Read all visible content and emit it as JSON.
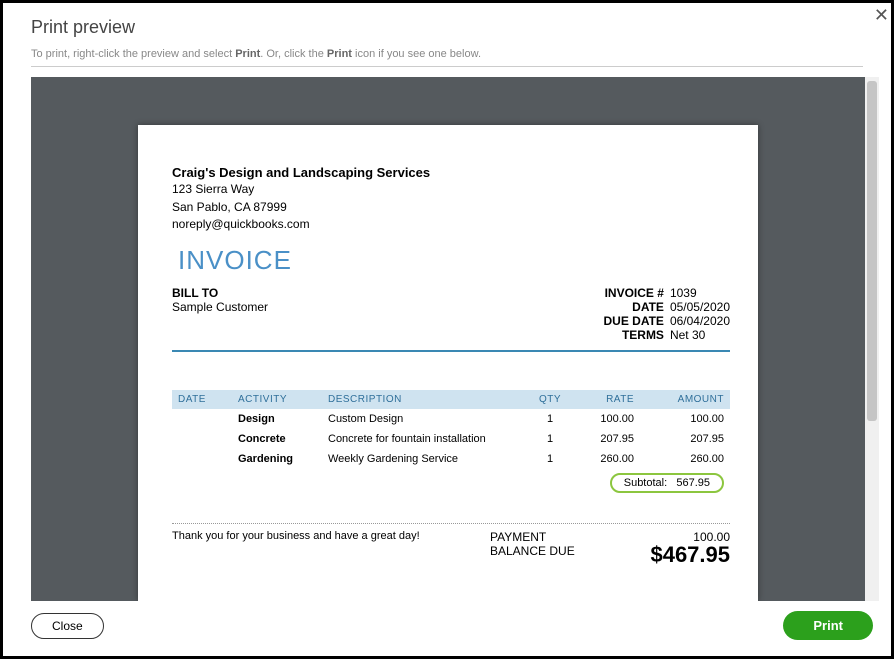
{
  "modal": {
    "title": "Print preview",
    "instruction_pre": "To print, right-click the preview and select ",
    "instruction_b1": "Print",
    "instruction_mid": ". Or, click the ",
    "instruction_b2": "Print",
    "instruction_post": " icon if you see one below.",
    "close_label": "Close",
    "print_label": "Print",
    "close_x": "✕"
  },
  "invoice": {
    "company": "Craig's Design and Landscaping Services",
    "addr1": "123 Sierra Way",
    "addr2": "San Pablo, CA  87999",
    "email": "noreply@quickbooks.com",
    "doc_title": "INVOICE",
    "billto_label": "BILL TO",
    "billto_name": "Sample Customer",
    "meta": {
      "invoice_no_label": "INVOICE #",
      "invoice_no": "1039",
      "date_label": "DATE",
      "date": "05/05/2020",
      "due_label": "DUE DATE",
      "due": "06/04/2020",
      "terms_label": "TERMS",
      "terms": "Net 30"
    },
    "columns": {
      "date": "DATE",
      "activity": "ACTIVITY",
      "description": "DESCRIPTION",
      "qty": "QTY",
      "rate": "RATE",
      "amount": "AMOUNT"
    },
    "lines": [
      {
        "date": "",
        "activity": "Design",
        "description": "Custom Design",
        "qty": "1",
        "rate": "100.00",
        "amount": "100.00"
      },
      {
        "date": "",
        "activity": "Concrete",
        "description": "Concrete for fountain installation",
        "qty": "1",
        "rate": "207.95",
        "amount": "207.95"
      },
      {
        "date": "",
        "activity": "Gardening",
        "description": "Weekly Gardening Service",
        "qty": "1",
        "rate": "260.00",
        "amount": "260.00"
      }
    ],
    "subtotal_label": "Subtotal:",
    "subtotal_value": "567.95",
    "thanks": "Thank you for your business and have a great day!",
    "payment_label": "PAYMENT",
    "payment_value": "100.00",
    "balance_label": "BALANCE DUE",
    "balance_value": "$467.95"
  }
}
